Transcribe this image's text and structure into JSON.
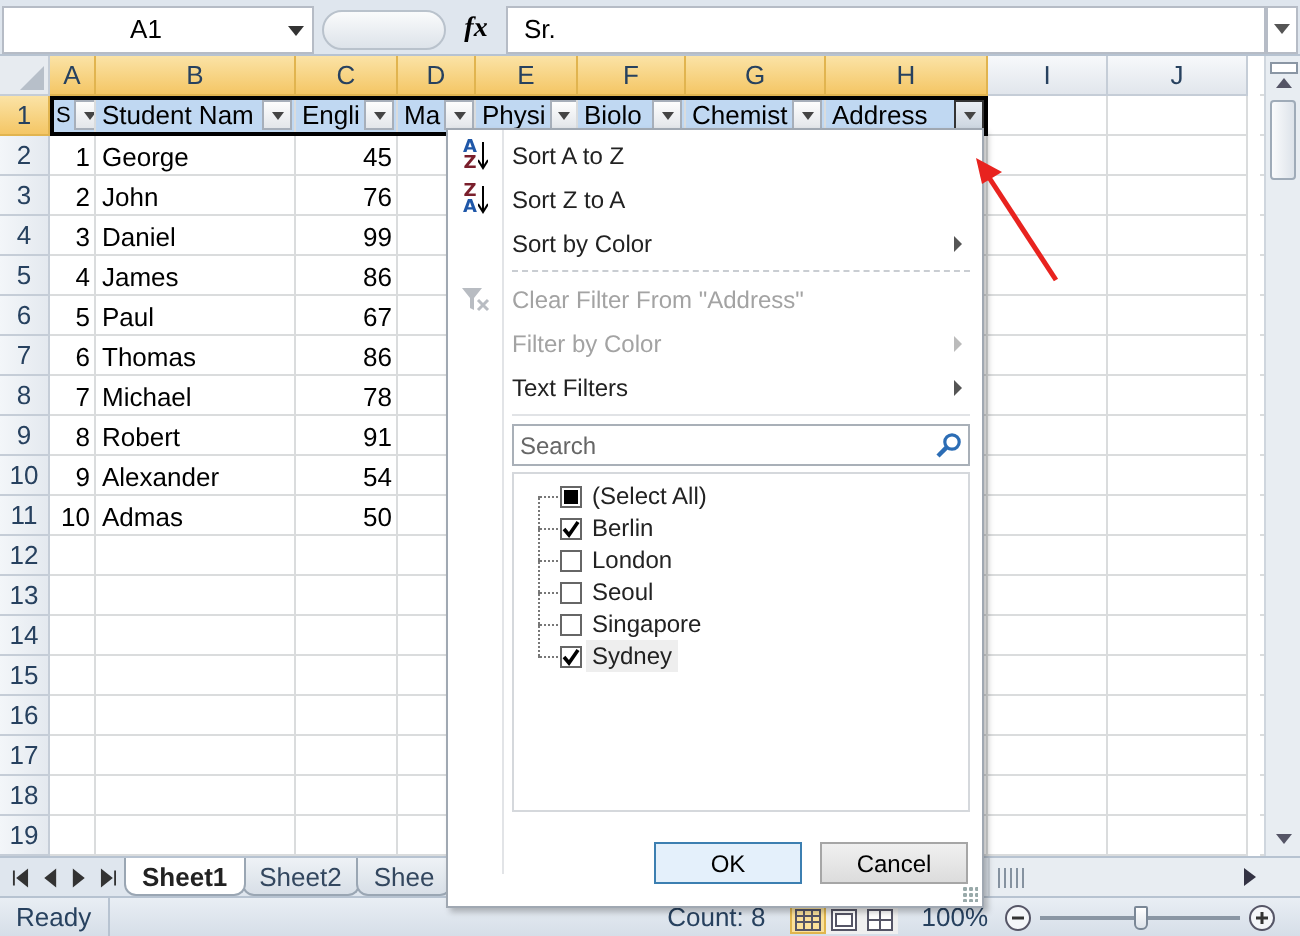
{
  "formula_bar": {
    "name_box": "A1",
    "fx_label": "fx",
    "formula": "Sr."
  },
  "columns": [
    {
      "letter": "A",
      "selected": true
    },
    {
      "letter": "B",
      "selected": true
    },
    {
      "letter": "C",
      "selected": true
    },
    {
      "letter": "D",
      "selected": true
    },
    {
      "letter": "E",
      "selected": true
    },
    {
      "letter": "F",
      "selected": true
    },
    {
      "letter": "G",
      "selected": true
    },
    {
      "letter": "H",
      "selected": true
    },
    {
      "letter": "I",
      "selected": false
    },
    {
      "letter": "J",
      "selected": false
    }
  ],
  "rows": [
    {
      "label": "1",
      "selected": true
    },
    {
      "label": "2",
      "selected": false
    },
    {
      "label": "3",
      "selected": false
    },
    {
      "label": "4",
      "selected": false
    },
    {
      "label": "5",
      "selected": false
    },
    {
      "label": "6",
      "selected": false
    },
    {
      "label": "7",
      "selected": false
    },
    {
      "label": "8",
      "selected": false
    },
    {
      "label": "9",
      "selected": false
    },
    {
      "label": "10",
      "selected": false
    },
    {
      "label": "11",
      "selected": false
    },
    {
      "label": "12",
      "selected": false
    },
    {
      "label": "13",
      "selected": false
    },
    {
      "label": "14",
      "selected": false
    },
    {
      "label": "15",
      "selected": false
    },
    {
      "label": "16",
      "selected": false
    },
    {
      "label": "17",
      "selected": false
    },
    {
      "label": "18",
      "selected": false
    },
    {
      "label": "19",
      "selected": false
    }
  ],
  "header_cells": [
    {
      "text": "S",
      "filter_open": false
    },
    {
      "text": "Student Nam",
      "filter_open": false
    },
    {
      "text": "Engli",
      "filter_open": false
    },
    {
      "text": "Ma",
      "filter_open": false
    },
    {
      "text": "Physi",
      "filter_open": false
    },
    {
      "text": "Biolo",
      "filter_open": false
    },
    {
      "text": "Chemist",
      "filter_open": false
    },
    {
      "text": "Address",
      "filter_open": true
    }
  ],
  "data_rows": [
    [
      "1",
      "George",
      "45"
    ],
    [
      "2",
      "John",
      "76"
    ],
    [
      "3",
      "Daniel",
      "99"
    ],
    [
      "4",
      "James",
      "86"
    ],
    [
      "5",
      "Paul",
      "67"
    ],
    [
      "6",
      "Thomas",
      "86"
    ],
    [
      "7",
      "Michael",
      "78"
    ],
    [
      "8",
      "Robert",
      "91"
    ],
    [
      "9",
      "Alexander",
      "54"
    ],
    [
      "10",
      "Admas",
      "50"
    ]
  ],
  "filter_menu": {
    "items": [
      {
        "kind": "sort",
        "icon_top": "A",
        "icon_bottom": "Z",
        "label": "Sort A to Z",
        "disabled": false,
        "submenu": false
      },
      {
        "kind": "sort",
        "icon_top": "Z",
        "icon_bottom": "A",
        "label": "Sort Z to A",
        "disabled": false,
        "submenu": false
      },
      {
        "kind": "plain",
        "label": "Sort by Color",
        "disabled": false,
        "submenu": true
      },
      {
        "kind": "separator"
      },
      {
        "kind": "clear",
        "label": "Clear Filter From \"Address\"",
        "disabled": true,
        "submenu": false
      },
      {
        "kind": "plain",
        "label": "Filter by Color",
        "disabled": true,
        "submenu": true
      },
      {
        "kind": "plain",
        "label": "Text Filters",
        "disabled": false,
        "submenu": true
      }
    ],
    "search": {
      "placeholder": "Search"
    },
    "values": [
      {
        "label": "(Select All)",
        "checked": false,
        "partial": true,
        "focused": false
      },
      {
        "label": "Berlin",
        "checked": true,
        "partial": false,
        "focused": false
      },
      {
        "label": "London",
        "checked": false,
        "partial": false,
        "focused": false
      },
      {
        "label": "Seoul",
        "checked": false,
        "partial": false,
        "focused": false
      },
      {
        "label": "Singapore",
        "checked": false,
        "partial": false,
        "focused": false
      },
      {
        "label": "Sydney",
        "checked": true,
        "partial": false,
        "focused": true
      }
    ],
    "buttons": [
      {
        "label": "OK",
        "default": true
      },
      {
        "label": "Cancel",
        "default": false
      }
    ]
  },
  "sheet_tabs": [
    {
      "label": "Sheet1",
      "selected": true
    },
    {
      "label": "Sheet2",
      "selected": false
    },
    {
      "label": "Shee",
      "selected": false
    }
  ],
  "status_bar": {
    "mode": "Ready",
    "count": "Count: 8",
    "views": [
      {
        "kind": "normal",
        "selected": true
      },
      {
        "kind": "page-layout",
        "selected": false
      },
      {
        "kind": "page-break",
        "selected": false
      }
    ],
    "zoom": "100%",
    "zoom_slider": {
      "level": 0.5
    }
  }
}
